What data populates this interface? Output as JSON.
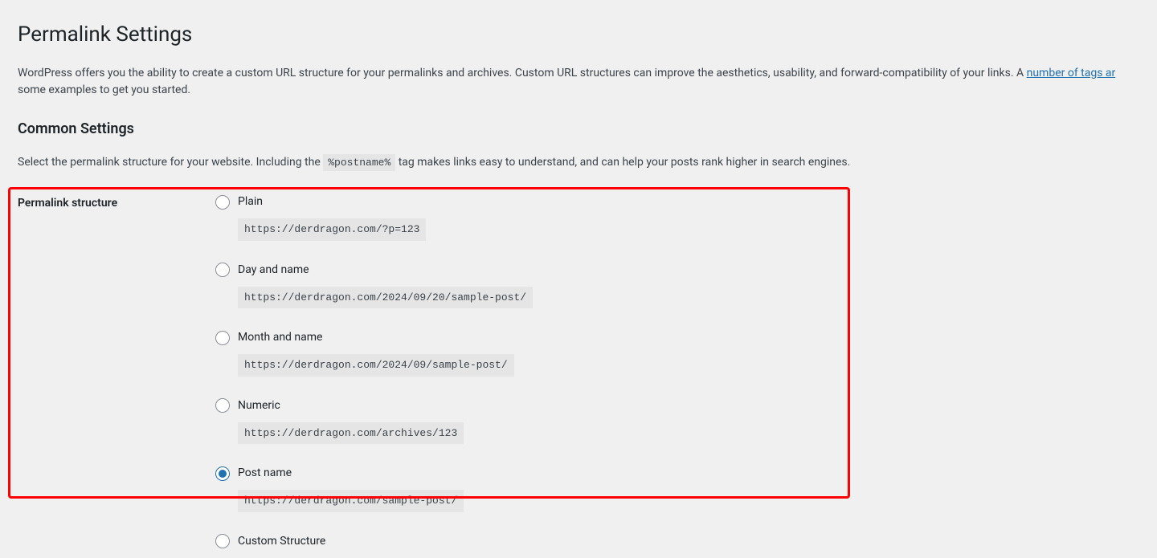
{
  "page_title": "Permalink Settings",
  "description_pre": "WordPress offers you the ability to create a custom URL structure for your permalinks and archives. Custom URL structures can improve the aesthetics, usability, and forward-compatibility of your links. A ",
  "description_link": "number of tags ar",
  "description_post": "some examples to get you started.",
  "common_settings_heading": "Common Settings",
  "common_settings_desc_pre": "Select the permalink structure for your website. Including the ",
  "common_settings_tag": "%postname%",
  "common_settings_desc_post": " tag makes links easy to understand, and can help your posts rank higher in search engines.",
  "structure_label": "Permalink structure",
  "options": {
    "plain": {
      "label": "Plain",
      "example": "https://derdragon.com/?p=123",
      "checked": false
    },
    "day_name": {
      "label": "Day and name",
      "example": "https://derdragon.com/2024/09/20/sample-post/",
      "checked": false
    },
    "month_name": {
      "label": "Month and name",
      "example": "https://derdragon.com/2024/09/sample-post/",
      "checked": false
    },
    "numeric": {
      "label": "Numeric",
      "example": "https://derdragon.com/archives/123",
      "checked": false
    },
    "post_name": {
      "label": "Post name",
      "example": "https://derdragon.com/sample-post/",
      "checked": true
    },
    "custom": {
      "label": "Custom Structure",
      "checked": false
    }
  }
}
